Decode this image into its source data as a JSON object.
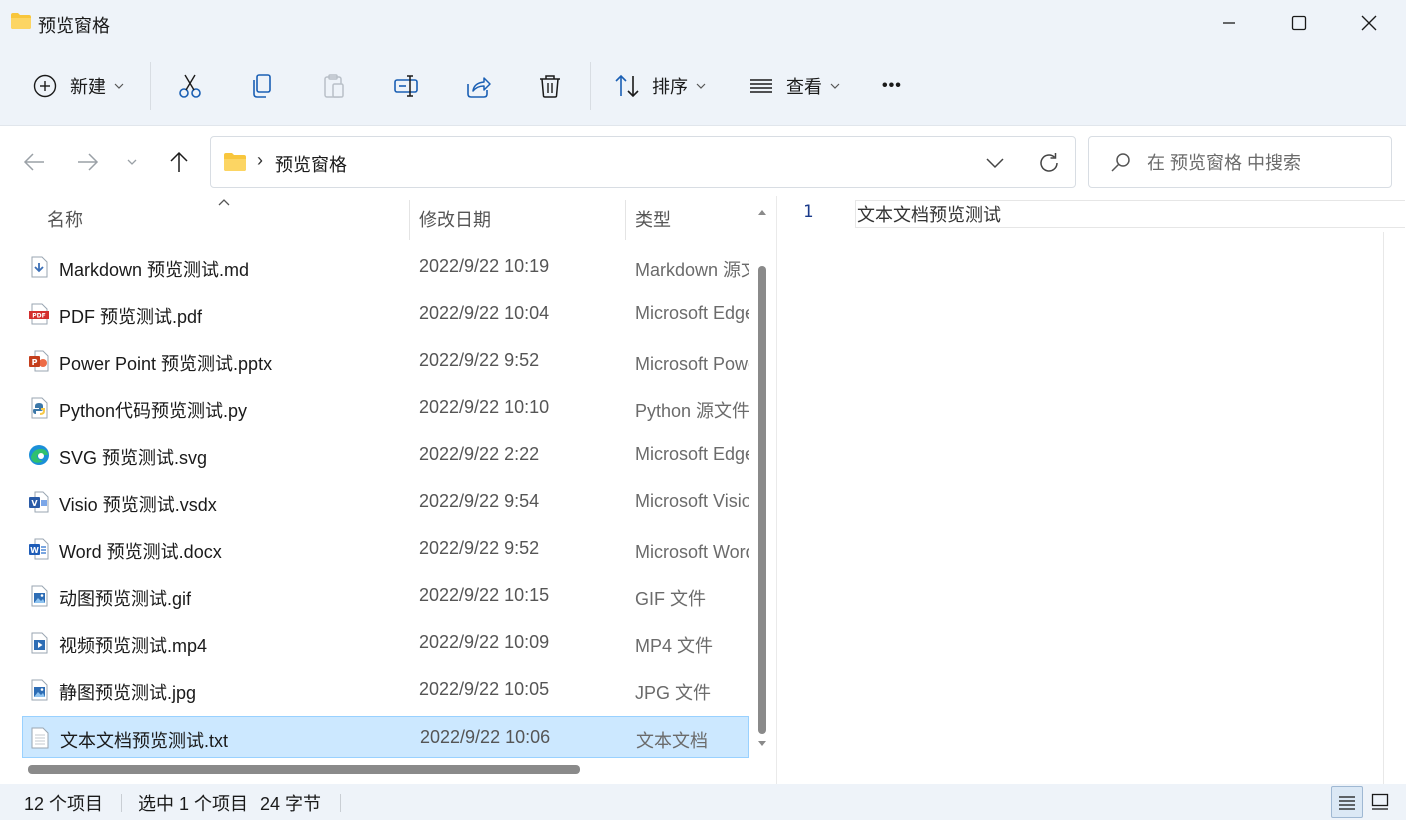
{
  "window": {
    "title": "预览窗格"
  },
  "toolbar": {
    "new_label": "新建",
    "sort_label": "排序",
    "view_label": "查看",
    "more_label": "•••"
  },
  "address": {
    "separator": "›",
    "path": "预览窗格"
  },
  "search": {
    "placeholder": "在 预览窗格 中搜索"
  },
  "columns": {
    "name": "名称",
    "date": "修改日期",
    "type": "类型"
  },
  "files": [
    {
      "name": "Markdown 预览测试.md",
      "date": "2022/9/22 10:19",
      "type": "Markdown 源文件",
      "icon": "markdown-file-icon"
    },
    {
      "name": "PDF 预览测试.pdf",
      "date": "2022/9/22 10:04",
      "type": "Microsoft Edge PDF Document",
      "icon": "pdf-file-icon"
    },
    {
      "name": "Power Point 预览测试.pptx",
      "date": "2022/9/22 9:52",
      "type": "Microsoft PowerPoint 演示文稿",
      "icon": "powerpoint-file-icon"
    },
    {
      "name": "Python代码预览测试.py",
      "date": "2022/9/22 10:10",
      "type": "Python 源文件",
      "icon": "python-file-icon"
    },
    {
      "name": "SVG 预览测试.svg",
      "date": "2022/9/22 2:22",
      "type": "Microsoft Edge HTML Document",
      "icon": "edge-file-icon"
    },
    {
      "name": "Visio 预览测试.vsdx",
      "date": "2022/9/22 9:54",
      "type": "Microsoft Visio Drawing",
      "icon": "visio-file-icon"
    },
    {
      "name": "Word 预览测试.docx",
      "date": "2022/9/22 9:52",
      "type": "Microsoft Word 文档",
      "icon": "word-file-icon"
    },
    {
      "name": "动图预览测试.gif",
      "date": "2022/9/22 10:15",
      "type": "GIF 文件",
      "icon": "image-file-icon"
    },
    {
      "name": "视频预览测试.mp4",
      "date": "2022/9/22 10:09",
      "type": "MP4 文件",
      "icon": "video-file-icon"
    },
    {
      "name": "静图预览测试.jpg",
      "date": "2022/9/22 10:05",
      "type": "JPG 文件",
      "icon": "image-file-icon"
    },
    {
      "name": "文本文档预览测试.txt",
      "date": "2022/9/22 10:06",
      "type": "文本文档",
      "icon": "text-file-icon",
      "selected": true
    }
  ],
  "preview": {
    "line_number": "1",
    "line_text": "文本文档预览测试"
  },
  "status": {
    "item_count": "12 个项目",
    "selection": "选中 1 个项目",
    "size": "24 字节"
  },
  "colors": {
    "chrome_bg": "#eef3f9",
    "selection_bg": "#cce8ff",
    "selection_border": "#99d1ff",
    "folder_yellow": "#f8c63d",
    "accent_blue": "#1a5fb4"
  }
}
